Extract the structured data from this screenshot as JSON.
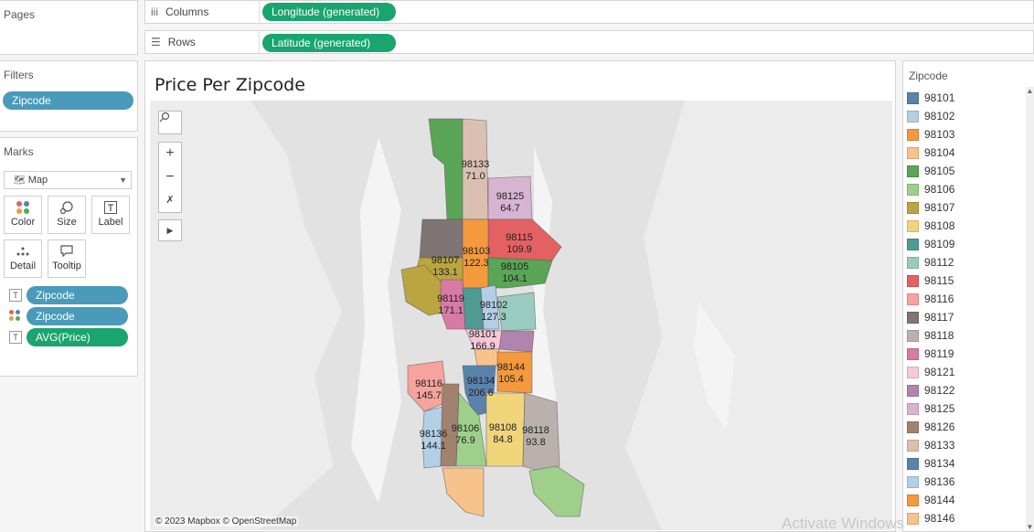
{
  "pages": {
    "title": "Pages"
  },
  "filters": {
    "title": "Filters",
    "pill": "Zipcode"
  },
  "marks": {
    "title": "Marks",
    "type": "Map",
    "buttons": {
      "color": "Color",
      "size": "Size",
      "label": "Label",
      "detail": "Detail",
      "tooltip": "Tooltip"
    },
    "fields": [
      "Zipcode",
      "Zipcode",
      "AVG(Price)"
    ]
  },
  "shelves": {
    "columns_label": "Columns",
    "columns_pill": "Longitude (generated)",
    "rows_label": "Rows",
    "rows_pill": "Latitude (generated)"
  },
  "sheet": {
    "title": "Price Per Zipcode",
    "copyright": "© 2023 Mapbox © OpenStreetMap"
  },
  "map_labels": [
    {
      "zip": "98133",
      "price": "71.0"
    },
    {
      "zip": "98125",
      "price": "64.7"
    },
    {
      "zip": "98115",
      "price": "109.9"
    },
    {
      "zip": "98103",
      "price": "122.3"
    },
    {
      "zip": "98107",
      "price": "133.1"
    },
    {
      "zip": "98105",
      "price": "104.1"
    },
    {
      "zip": "98119",
      "price": "171.1"
    },
    {
      "zip": "98102",
      "price": "127.3"
    },
    {
      "zip": "98101",
      "price": "166.9"
    },
    {
      "zip": "98144",
      "price": "105.4"
    },
    {
      "zip": "98134",
      "price": "206.6"
    },
    {
      "zip": "98116",
      "price": "145.7"
    },
    {
      "zip": "98136",
      "price": "144.1"
    },
    {
      "zip": "98106",
      "price": "76.9"
    },
    {
      "zip": "98108",
      "price": "84.8"
    },
    {
      "zip": "98118",
      "price": "93.8"
    }
  ],
  "legend": {
    "title": "Zipcode",
    "items": [
      {
        "zip": "98101",
        "color": "#5b82aa"
      },
      {
        "zip": "98102",
        "color": "#b3cfe6"
      },
      {
        "zip": "98103",
        "color": "#f3993e"
      },
      {
        "zip": "98104",
        "color": "#f8c38b"
      },
      {
        "zip": "98105",
        "color": "#5aa556"
      },
      {
        "zip": "98106",
        "color": "#9ed08b"
      },
      {
        "zip": "98107",
        "color": "#bba541"
      },
      {
        "zip": "98108",
        "color": "#f1d57b"
      },
      {
        "zip": "98109",
        "color": "#4f9a92"
      },
      {
        "zip": "98112",
        "color": "#9acbc1"
      },
      {
        "zip": "98115",
        "color": "#e36163"
      },
      {
        "zip": "98116",
        "color": "#f5a39c"
      },
      {
        "zip": "98117",
        "color": "#7f7574"
      },
      {
        "zip": "98118",
        "color": "#bab1ac"
      },
      {
        "zip": "98119",
        "color": "#d77ba4"
      },
      {
        "zip": "98121",
        "color": "#f9c8d8"
      },
      {
        "zip": "98122",
        "color": "#b184b0"
      },
      {
        "zip": "98125",
        "color": "#d8b4d3"
      },
      {
        "zip": "98126",
        "color": "#a1826f"
      },
      {
        "zip": "98133",
        "color": "#dbc0b1"
      },
      {
        "zip": "98134",
        "color": "#5b82aa"
      },
      {
        "zip": "98136",
        "color": "#b3cfe6"
      },
      {
        "zip": "98144",
        "color": "#f3993e"
      },
      {
        "zip": "98146",
        "color": "#f8c38b"
      }
    ]
  },
  "watermark": "Activate Windows"
}
